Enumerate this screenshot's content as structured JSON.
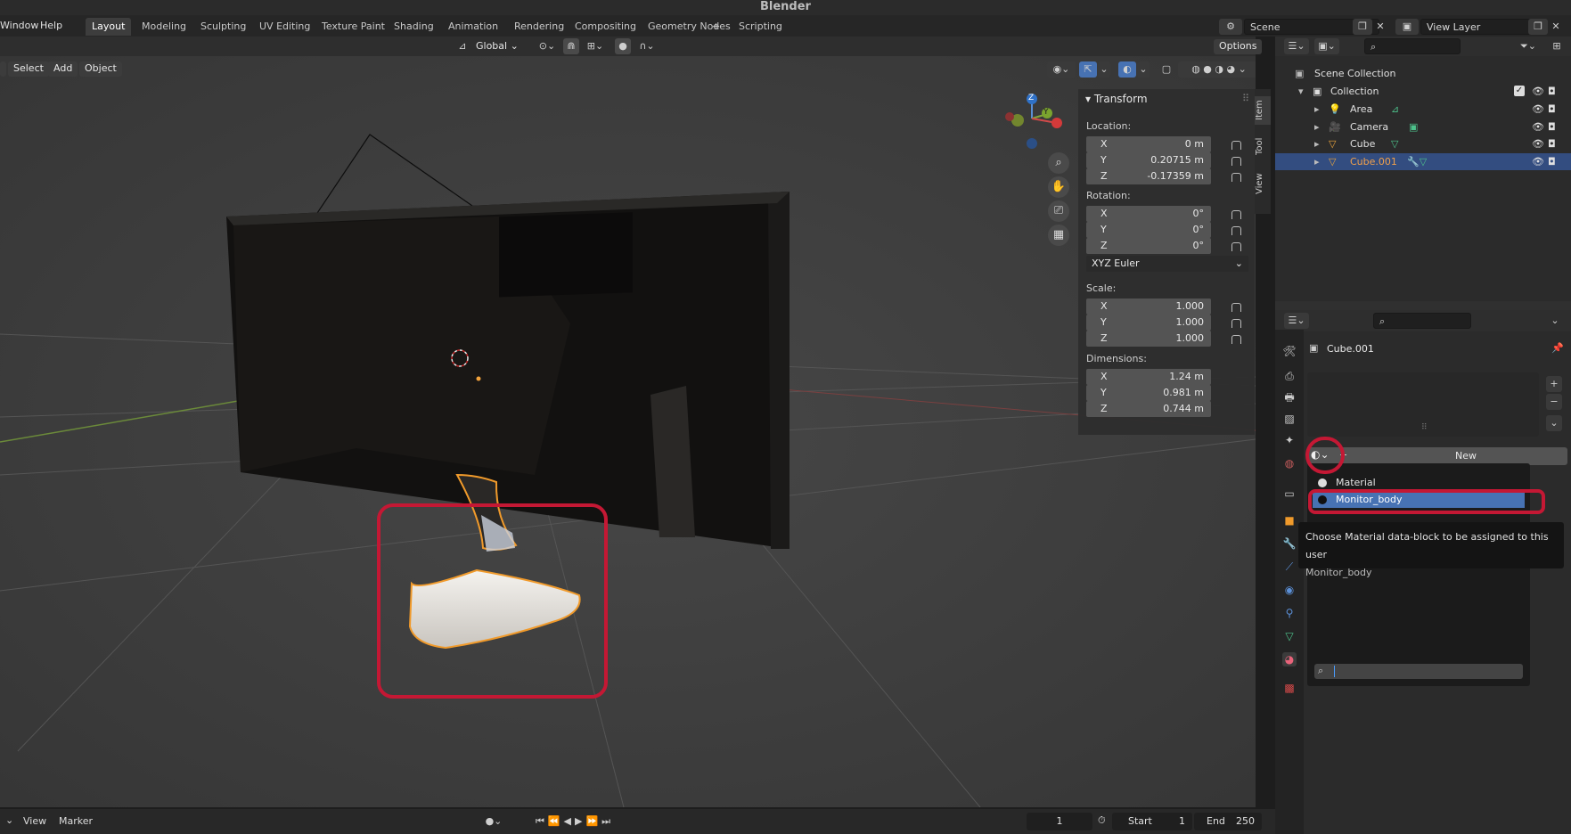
{
  "app": {
    "title": "Blender"
  },
  "menu": {
    "window": "Window",
    "help": "Help"
  },
  "workspaces": [
    "Layout",
    "Modeling",
    "Sculpting",
    "UV Editing",
    "Texture Paint",
    "Shading",
    "Animation",
    "Rendering",
    "Compositing",
    "Geometry Nodes",
    "Scripting"
  ],
  "add_workspace": "+",
  "scene": {
    "label": "Scene",
    "view_layer": "View Layer"
  },
  "viewport_header": {
    "transform_orientation": "Global",
    "options": "Options"
  },
  "viewport_menu": {
    "select": "Select",
    "add": "Add",
    "object": "Object"
  },
  "npanel": {
    "title": "Transform",
    "location_label": "Location:",
    "location": {
      "x": "0 m",
      "y": "0.20715 m",
      "z": "-0.17359 m"
    },
    "rotation_label": "Rotation:",
    "rotation": {
      "x": "0°",
      "y": "0°",
      "z": "0°"
    },
    "rotation_mode": "XYZ Euler",
    "scale_label": "Scale:",
    "scale": {
      "x": "1.000",
      "y": "1.000",
      "z": "1.000"
    },
    "dimensions_label": "Dimensions:",
    "dimensions": {
      "x": "1.24 m",
      "y": "0.981 m",
      "z": "0.744 m"
    },
    "axes": {
      "x": "X",
      "y": "Y",
      "z": "Z"
    },
    "tabs": {
      "item": "Item",
      "tool": "Tool",
      "view": "View"
    }
  },
  "gizmo": {
    "z": "Z",
    "y": "Y"
  },
  "outliner": {
    "scene_collection": "Scene Collection",
    "collection": "Collection",
    "items": [
      "Area",
      "Camera",
      "Cube",
      "Cube.001"
    ]
  },
  "properties": {
    "object_name": "Cube.001",
    "new_button": "New",
    "slot_add": "+",
    "slot_remove": "−",
    "dropdown_items": [
      "Material",
      "Monitor_body"
    ],
    "tooltip_title": "Choose Material data-block to be assigned to this user",
    "tooltip_value": "Monitor_body",
    "colors": {
      "selected": "#4772b3",
      "highlight": "#c41834"
    }
  },
  "timeline": {
    "view": "View",
    "marker": "Marker",
    "current_frame": "1",
    "start_label": "Start",
    "start": "1",
    "end_label": "End",
    "end": "250"
  }
}
